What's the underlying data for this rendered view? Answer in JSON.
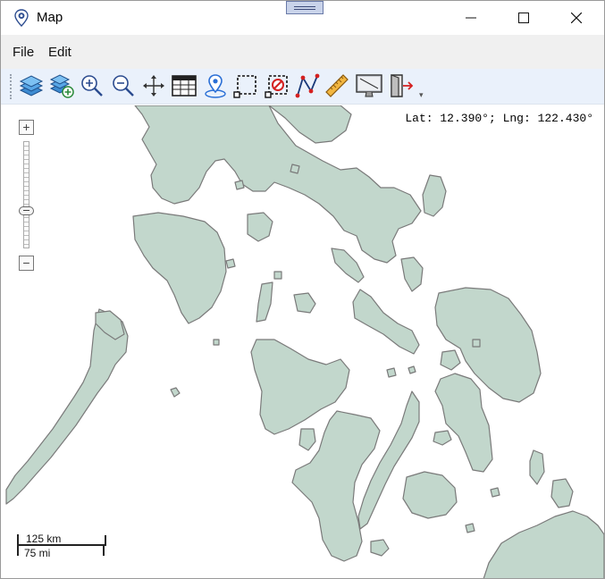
{
  "window": {
    "title": "Map"
  },
  "menu": {
    "items": [
      "File",
      "Edit"
    ]
  },
  "toolbar": {
    "tools": [
      {
        "icon": "layers-icon",
        "label": "Layers"
      },
      {
        "icon": "add-layer-icon",
        "label": "Add layer"
      },
      {
        "icon": "zoom-in-icon",
        "label": "Zoom in"
      },
      {
        "icon": "zoom-out-icon",
        "label": "Zoom out"
      },
      {
        "icon": "pan-icon",
        "label": "Pan"
      },
      {
        "icon": "attribute-table-icon",
        "label": "Attribute table"
      },
      {
        "icon": "map-pin-icon",
        "label": "Place marker"
      },
      {
        "icon": "select-region-icon",
        "label": "Select"
      },
      {
        "icon": "clear-selection-icon",
        "label": "Clear selection"
      },
      {
        "icon": "draw-path-icon",
        "label": "Draw path"
      },
      {
        "icon": "ruler-icon",
        "label": "Measure"
      },
      {
        "icon": "screen-icon",
        "label": "Full extent"
      },
      {
        "icon": "exit-icon",
        "label": "Exit"
      }
    ],
    "overflow": "▾"
  },
  "map": {
    "coordinates": "Lat: 12.390°; Lng: 122.430°",
    "zoom": {
      "in": "+",
      "out": "−"
    },
    "scale": {
      "km": "125 km",
      "mi": "75 mi"
    },
    "land_color": "#c2d7cc",
    "coast_color": "#7a7a7a",
    "water_color": "#ffffff"
  },
  "colors": {
    "toolbar_bg": "#eaf1fb",
    "menubar_bg": "#f0f0f0",
    "accent": "#2a6fd6"
  }
}
